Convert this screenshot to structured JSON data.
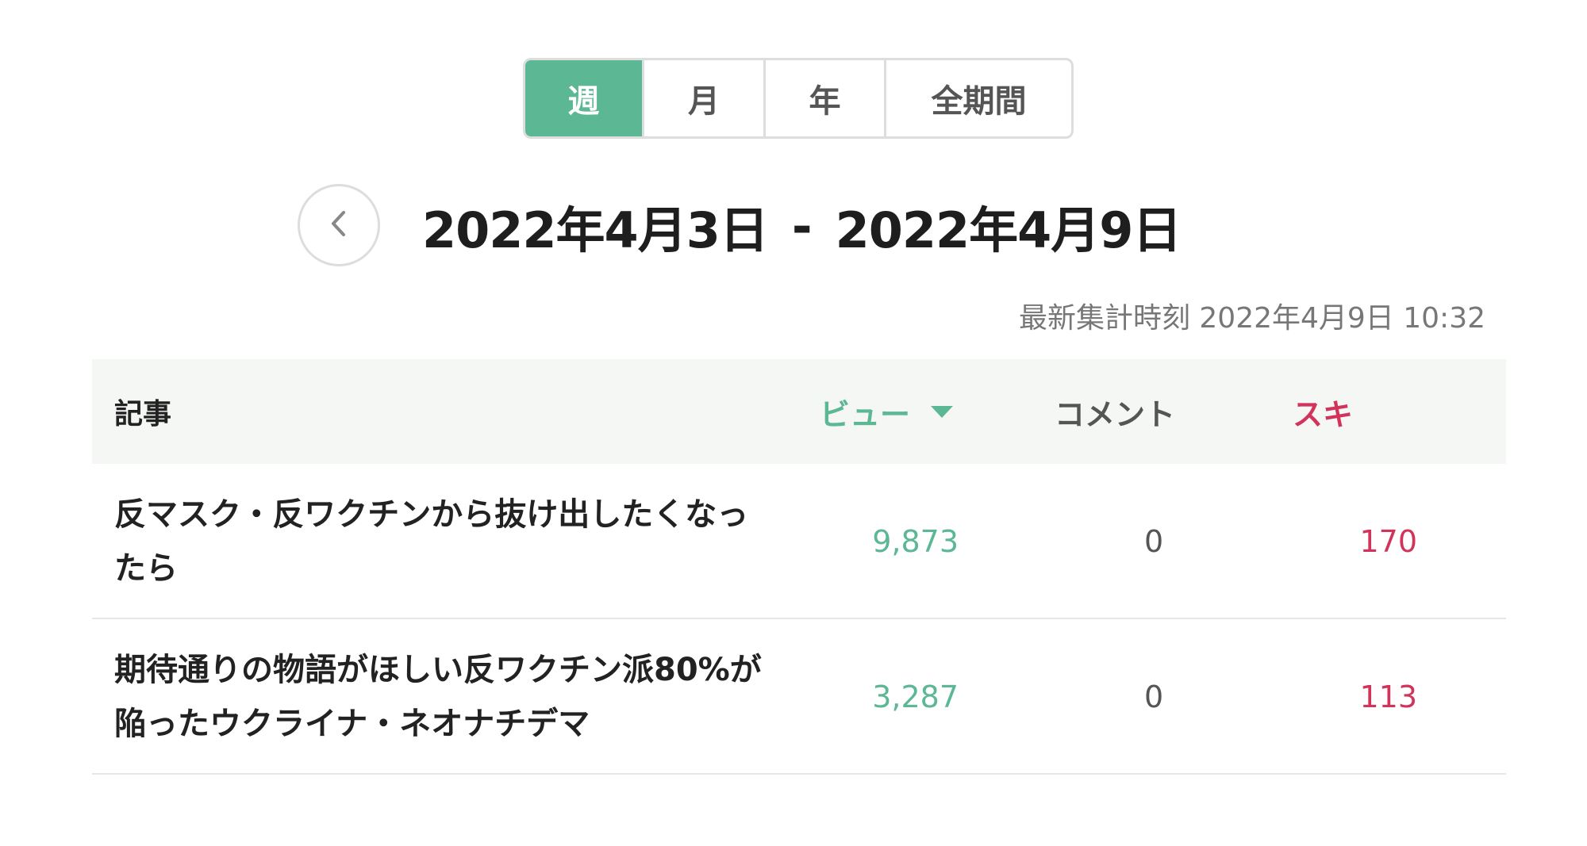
{
  "period_tabs": [
    {
      "label": "週",
      "active": true
    },
    {
      "label": "月",
      "active": false
    },
    {
      "label": "年",
      "active": false
    },
    {
      "label": "全期間",
      "active": false
    }
  ],
  "date_range": {
    "start": "2022年4月3日",
    "separator": "-",
    "end": "2022年4月9日",
    "prev_icon": "chevron-left-icon"
  },
  "updated_at": "最新集計時刻 2022年4月9日 10:32",
  "table": {
    "headers": {
      "article": "記事",
      "views": "ビュー",
      "comments": "コメント",
      "likes": "スキ",
      "sort_icon": "caret-down-icon"
    },
    "rows": [
      {
        "title": "反マスク・反ワクチンから抜け出したくなったら",
        "views": "9,873",
        "comments": "0",
        "likes": "170"
      },
      {
        "title": "期待通りの物語がほしい反ワクチン派80%が陥ったウクライナ・ネオナチデマ",
        "views": "3,287",
        "comments": "0",
        "likes": "113"
      }
    ]
  },
  "colors": {
    "accent_green": "#5cb795",
    "like_red": "#d2335b",
    "header_bg": "#f5f7f5",
    "border": "#dddddd"
  }
}
